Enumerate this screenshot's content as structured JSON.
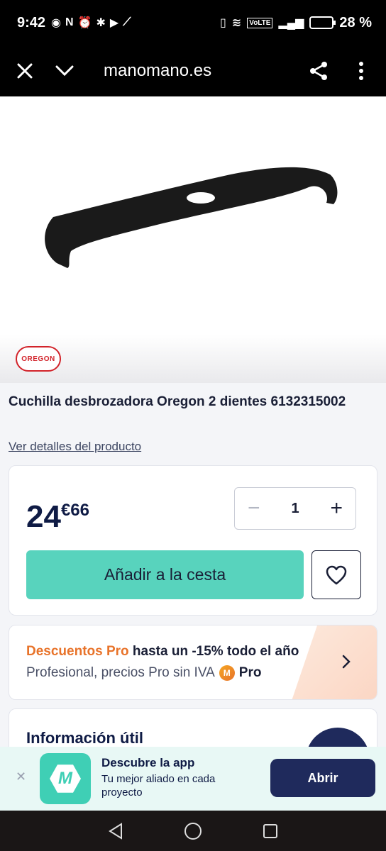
{
  "status_bar": {
    "time": "9:42",
    "battery": "28 %"
  },
  "browser": {
    "url": "manomano.es"
  },
  "product": {
    "brand": "OREGON",
    "title": "Cuchilla desbrozadora Oregon 2 dientes 6132315002",
    "details_link": "Ver detalles del producto"
  },
  "purchase": {
    "price_int": "24",
    "price_dec": "€66",
    "quantity": "1",
    "add_to_cart": "Añadir a la cesta"
  },
  "pro": {
    "highlight": "Descuentos Pro",
    "rest": " hasta un -15% todo el año",
    "line2": "Profesional, precios Pro sin IVA",
    "badge": "M",
    "badge_text": "Pro"
  },
  "info": {
    "title": "Información útil"
  },
  "app_banner": {
    "title": "Descubre la app",
    "subtitle": "Tu mejor aliado en cada proyecto",
    "open": "Abrir",
    "icon_letter": "M"
  }
}
